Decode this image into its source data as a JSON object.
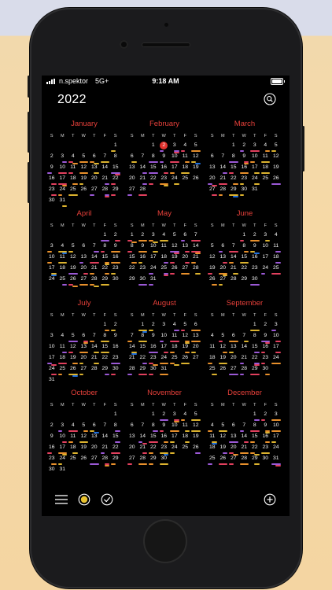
{
  "status": {
    "carrier": "n.spektor",
    "network": "5G+",
    "time": "9:18 AM"
  },
  "header": {
    "year": "2022"
  },
  "weekday_labels": [
    "S",
    "M",
    "T",
    "W",
    "T",
    "F",
    "S"
  ],
  "colors": {
    "accent": "#e6403a",
    "today": "#e3322d",
    "events": [
      "#1e6fdd",
      "#e8902c",
      "#9b59d6",
      "#dcb32f",
      "#e2405e"
    ]
  },
  "today": {
    "month": 1,
    "day": 2
  },
  "months": [
    {
      "name": "January",
      "start": 6,
      "days": 31
    },
    {
      "name": "February",
      "start": 2,
      "days": 28
    },
    {
      "name": "March",
      "start": 2,
      "days": 31
    },
    {
      "name": "April",
      "start": 5,
      "days": 30
    },
    {
      "name": "May",
      "start": 0,
      "days": 31
    },
    {
      "name": "June",
      "start": 3,
      "days": 30
    },
    {
      "name": "July",
      "start": 5,
      "days": 31
    },
    {
      "name": "August",
      "start": 1,
      "days": 31
    },
    {
      "name": "September",
      "start": 4,
      "days": 30
    },
    {
      "name": "October",
      "start": 6,
      "days": 31
    },
    {
      "name": "November",
      "start": 2,
      "days": 30
    },
    {
      "name": "December",
      "start": 4,
      "days": 31
    }
  ],
  "toolbar": {
    "menu_icon": "menu-icon",
    "today_icon": "today-circle-icon",
    "done_icon": "checkmark-circle-icon",
    "add_icon": "plus-circle-icon"
  }
}
